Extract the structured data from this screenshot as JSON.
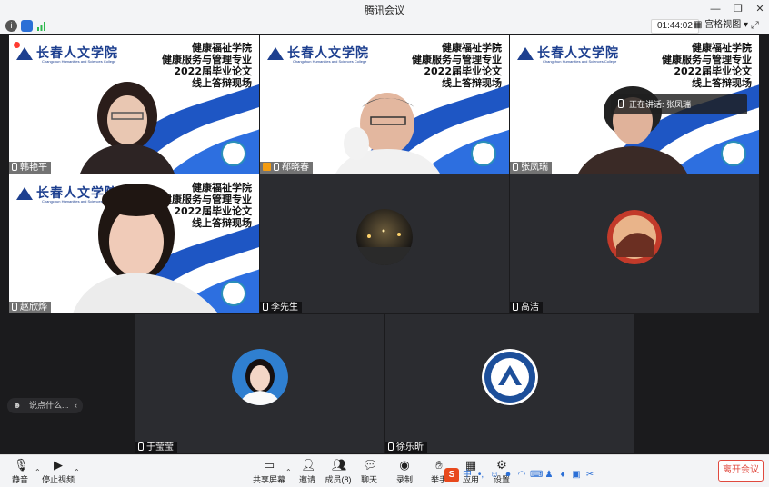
{
  "window": {
    "title": "腾讯会议"
  },
  "topbar": {
    "time": "01:44:02",
    "view_mode": "宫格视图"
  },
  "slide": {
    "logo_text": "长春人文学院",
    "logo_sub": "Changchun Humanities and Sciences College",
    "lines": [
      "健康福祉学院",
      "健康服务与管理专业",
      "2022届毕业论文",
      "线上答辩现场"
    ]
  },
  "participants": [
    {
      "name": "韩艳平"
    },
    {
      "name": "郗晓春"
    },
    {
      "name": "张凤瑞"
    },
    {
      "name": "赵欣烨"
    },
    {
      "name": "李先生"
    },
    {
      "name": "高洁"
    },
    {
      "name": "于莹莹"
    },
    {
      "name": "徐乐昕"
    }
  ],
  "speaking": {
    "label": "正在讲话: 张凤瑞"
  },
  "chat": {
    "placeholder": "说点什么..."
  },
  "toolbar": {
    "mute": "静音",
    "video": "停止视频",
    "share": "共享屏幕",
    "invite": "邀请",
    "members": "成员(8)",
    "chat": "聊天",
    "record": "录制",
    "raise": "举手",
    "apps": "应用",
    "settings": "设置",
    "leave": "离开会议"
  },
  "colors": {
    "accent": "#1e56c4",
    "leave": "#e04a3f",
    "host_badge": "#f39c12"
  }
}
